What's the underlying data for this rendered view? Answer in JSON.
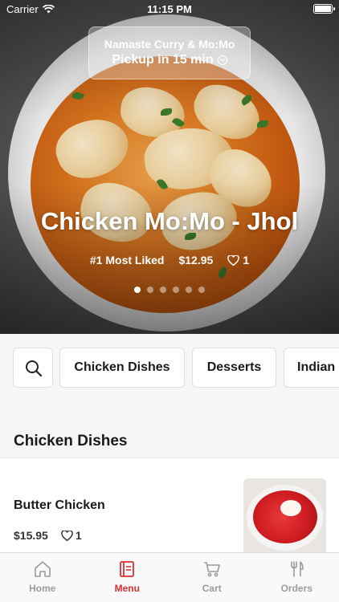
{
  "status_bar": {
    "carrier": "Carrier",
    "time": "11:15 PM"
  },
  "restaurant": {
    "name": "Namaste Curry & Mo:Mo",
    "pickup": "Pickup in 15 min"
  },
  "hero": {
    "title": "Chicken Mo:Mo - Jhol",
    "rank": "#1 Most Liked",
    "price": "$12.95",
    "likes": "1",
    "carousel_count": 6,
    "carousel_active": 1
  },
  "categories": [
    "Chicken Dishes",
    "Desserts",
    "Indian"
  ],
  "section": {
    "title": "Chicken Dishes"
  },
  "items": [
    {
      "name": "Butter Chicken",
      "price": "$15.95",
      "likes": "1"
    }
  ],
  "tabs": [
    {
      "label": "Home",
      "icon": "home-icon",
      "active": false
    },
    {
      "label": "Menu",
      "icon": "menu-icon",
      "active": true
    },
    {
      "label": "Cart",
      "icon": "cart-icon",
      "active": false
    },
    {
      "label": "Orders",
      "icon": "orders-icon",
      "active": false
    }
  ],
  "colors": {
    "accent": "#e02e2e",
    "inactive": "#9b9b9b"
  }
}
